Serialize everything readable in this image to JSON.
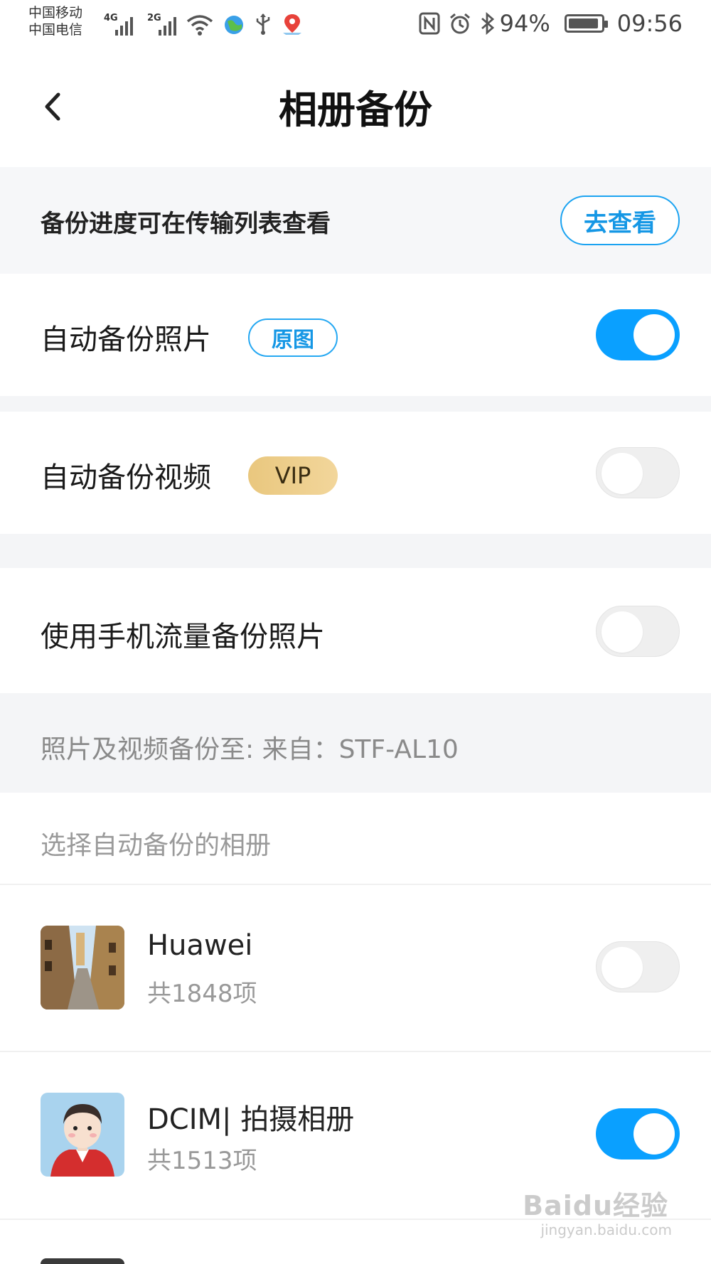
{
  "status_bar": {
    "carrier1": "中国移动",
    "carrier2": "中国电信",
    "net1": "4G",
    "net2": "2G",
    "battery": "94%",
    "battery_level": 0.94,
    "time": "09:56"
  },
  "header": {
    "title": "相册备份"
  },
  "info": {
    "text": "备份进度可在传输列表查看",
    "button": "去查看"
  },
  "settings": {
    "photo_label": "自动备份照片",
    "photo_badge": "原图",
    "photo_on": true,
    "video_label": "自动备份视频",
    "video_badge": "VIP",
    "video_on": false,
    "mobile_label": "使用手机流量备份照片",
    "mobile_on": false
  },
  "destination": {
    "text": "照片及视频备份至:  来自：STF-AL10"
  },
  "albums": {
    "section_label": "选择自动备份的相册",
    "items": [
      {
        "name": "Huawei",
        "count": "共1848项",
        "on": false
      },
      {
        "name": "DCIM| 拍摄相册",
        "count": "共1513项",
        "on": true
      }
    ]
  },
  "watermark": {
    "main": "Baidu经验",
    "sub": "jingyan.baidu.com"
  },
  "colors": {
    "accent": "#0aa0ff",
    "vip": "#ecce8c"
  }
}
